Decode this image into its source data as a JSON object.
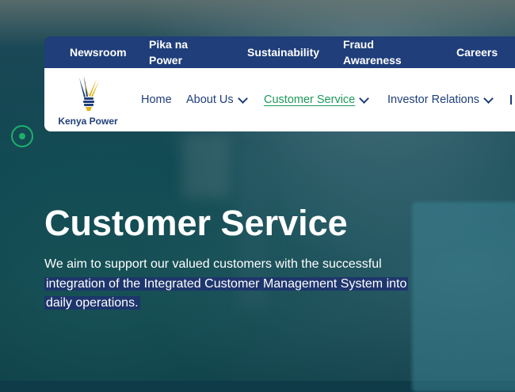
{
  "topbar": {
    "items": [
      {
        "label": "Newsroom"
      },
      {
        "label_line1": "Pika na",
        "label_line2": "Power"
      },
      {
        "label": "Sustainability"
      },
      {
        "label_line1": "Fraud",
        "label_line2": "Awareness"
      },
      {
        "label": "Careers"
      }
    ]
  },
  "logo": {
    "text": "Kenya Power"
  },
  "nav": {
    "items": [
      {
        "label": "Home"
      },
      {
        "label": "About Us"
      },
      {
        "label": "Customer Service"
      },
      {
        "label": "Investor Relations"
      }
    ],
    "active": "Customer Service"
  },
  "hero": {
    "title": "Customer Service",
    "line1": "We aim to support our valued customers with the successful",
    "line2": "integration of the Integrated Customer Management System into",
    "line3": "daily operations."
  },
  "colors": {
    "brand_blue": "#1f3e7a",
    "accent_green": "#1b9a5a",
    "hero_bg": "#0f3a47"
  }
}
